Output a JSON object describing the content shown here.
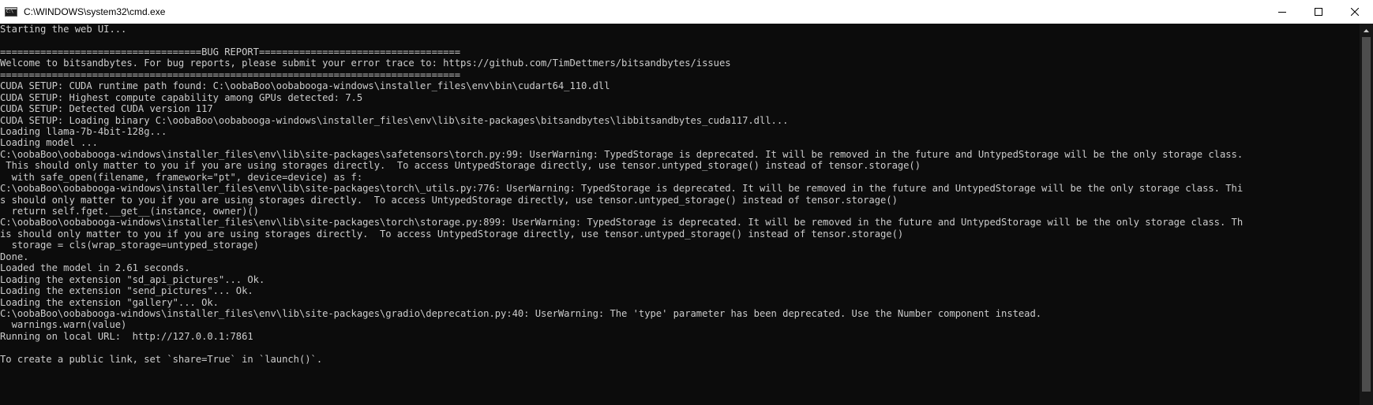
{
  "window": {
    "title": "C:\\WINDOWS\\system32\\cmd.exe",
    "icon": "cmd-icon"
  },
  "controls": {
    "minimize": "minimize-icon",
    "maximize": "maximize-icon",
    "close": "close-icon"
  },
  "console": {
    "background": "#0c0c0c",
    "foreground": "#cccccc",
    "lines": [
      "Starting the web UI...",
      "",
      "===================================BUG REPORT===================================",
      "Welcome to bitsandbytes. For bug reports, please submit your error trace to: https://github.com/TimDettmers/bitsandbytes/issues",
      "================================================================================",
      "CUDA SETUP: CUDA runtime path found: C:\\oobaBoo\\oobabooga-windows\\installer_files\\env\\bin\\cudart64_110.dll",
      "CUDA SETUP: Highest compute capability among GPUs detected: 7.5",
      "CUDA SETUP: Detected CUDA version 117",
      "CUDA SETUP: Loading binary C:\\oobaBoo\\oobabooga-windows\\installer_files\\env\\lib\\site-packages\\bitsandbytes\\libbitsandbytes_cuda117.dll...",
      "Loading llama-7b-4bit-128g...",
      "Loading model ...",
      "C:\\oobaBoo\\oobabooga-windows\\installer_files\\env\\lib\\site-packages\\safetensors\\torch.py:99: UserWarning: TypedStorage is deprecated. It will be removed in the future and UntypedStorage will be the only storage class.",
      " This should only matter to you if you are using storages directly.  To access UntypedStorage directly, use tensor.untyped_storage() instead of tensor.storage()",
      "  with safe_open(filename, framework=\"pt\", device=device) as f:",
      "C:\\oobaBoo\\oobabooga-windows\\installer_files\\env\\lib\\site-packages\\torch\\_utils.py:776: UserWarning: TypedStorage is deprecated. It will be removed in the future and UntypedStorage will be the only storage class. Thi",
      "s should only matter to you if you are using storages directly.  To access UntypedStorage directly, use tensor.untyped_storage() instead of tensor.storage()",
      "  return self.fget.__get__(instance, owner)()",
      "C:\\oobaBoo\\oobabooga-windows\\installer_files\\env\\lib\\site-packages\\torch\\storage.py:899: UserWarning: TypedStorage is deprecated. It will be removed in the future and UntypedStorage will be the only storage class. Th",
      "is should only matter to you if you are using storages directly.  To access UntypedStorage directly, use tensor.untyped_storage() instead of tensor.storage()",
      "  storage = cls(wrap_storage=untyped_storage)",
      "Done.",
      "Loaded the model in 2.61 seconds.",
      "Loading the extension \"sd_api_pictures\"... Ok.",
      "Loading the extension \"send_pictures\"... Ok.",
      "Loading the extension \"gallery\"... Ok.",
      "C:\\oobaBoo\\oobabooga-windows\\installer_files\\env\\lib\\site-packages\\gradio\\deprecation.py:40: UserWarning: The 'type' parameter has been deprecated. Use the Number component instead.",
      "  warnings.warn(value)",
      "Running on local URL:  http://127.0.0.1:7861",
      "",
      "To create a public link, set `share=True` in `launch()`."
    ]
  }
}
